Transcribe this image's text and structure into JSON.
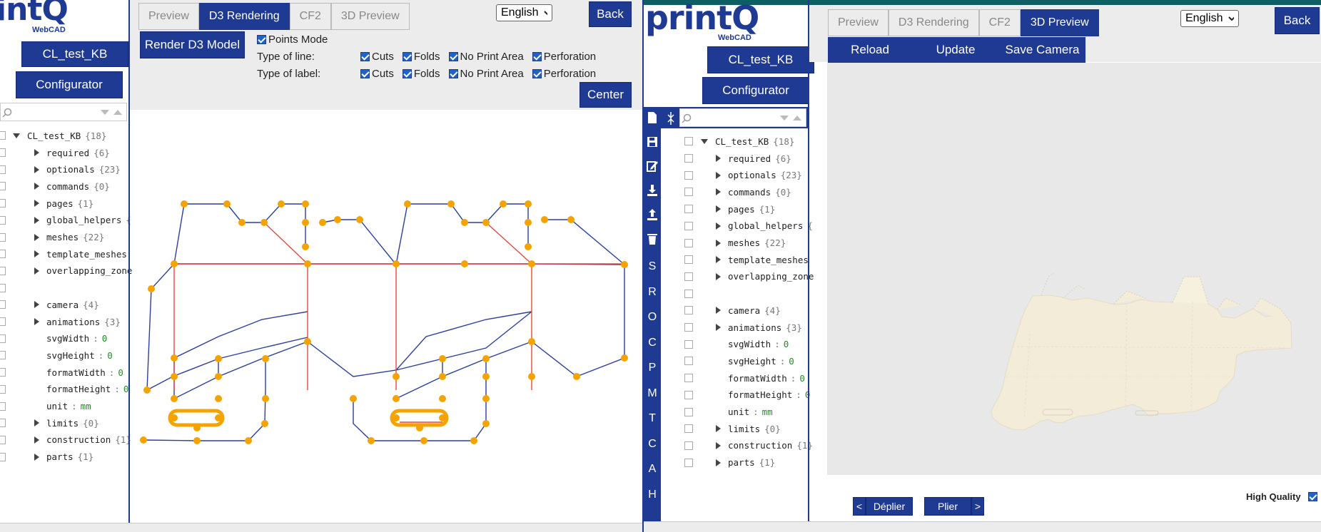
{
  "left": {
    "logo_text": "intQ",
    "logo_sub": "WebCAD",
    "project_button": "CL_test_KB",
    "configurator_button": "Configurator",
    "tabs": [
      {
        "label": "Preview",
        "active": false
      },
      {
        "label": "D3 Rendering",
        "active": true
      },
      {
        "label": "CF2",
        "active": false
      },
      {
        "label": "3D Preview",
        "active": false
      }
    ],
    "language": "English",
    "back_label": "Back",
    "render_button": "Render D3 Model",
    "points_mode_label": "Points Mode",
    "line_type_label": "Type of line:",
    "label_type_label": "Type of label:",
    "options": [
      "Cuts",
      "Folds",
      "No Print Area",
      "Perforation"
    ],
    "center_label": "Center",
    "tree_root": {
      "label": "CL_test_KB",
      "count": "{18}"
    },
    "tree": [
      {
        "label": "required",
        "count": "{6}",
        "type": "node"
      },
      {
        "label": "optionals",
        "count": "{23}",
        "type": "node"
      },
      {
        "label": "commands",
        "count": "{0}",
        "type": "node"
      },
      {
        "label": "pages",
        "count": "{1}",
        "type": "node"
      },
      {
        "label": "global_helpers",
        "count": "{",
        "type": "node"
      },
      {
        "label": "meshes",
        "count": "{22}",
        "type": "node"
      },
      {
        "label": "template_meshes",
        "count": "",
        "type": "node"
      },
      {
        "label": "overlapping_zone",
        "count": "",
        "type": "node"
      },
      {
        "label": "",
        "count": "",
        "type": "blank"
      },
      {
        "label": "camera",
        "count": "{4}",
        "type": "node"
      },
      {
        "label": "animations",
        "count": "{3}",
        "type": "node"
      },
      {
        "label": "svgWidth",
        "value": "0",
        "type": "leaf"
      },
      {
        "label": "svgHeight",
        "value": "0",
        "type": "leaf"
      },
      {
        "label": "formatWidth",
        "value": "0",
        "type": "leaf"
      },
      {
        "label": "formatHeight",
        "value": "0",
        "type": "leaf"
      },
      {
        "label": "unit",
        "value": "mm",
        "type": "leaf"
      },
      {
        "label": "limits",
        "count": "{0}",
        "type": "node"
      },
      {
        "label": "construction",
        "count": "{1}",
        "type": "node"
      },
      {
        "label": "parts",
        "count": "{1}",
        "type": "node"
      }
    ]
  },
  "right": {
    "logo_text": "printQ",
    "logo_sub": "WebCAD",
    "project_button": "CL_test_KB",
    "configurator_button": "Configurator",
    "tabs": [
      {
        "label": "Preview",
        "active": false
      },
      {
        "label": "D3 Rendering",
        "active": false
      },
      {
        "label": "CF2",
        "active": false
      },
      {
        "label": "3D Preview",
        "active": true
      }
    ],
    "language": "English",
    "back_label": "Back",
    "reload_label": "Reload",
    "update_label": "Update",
    "save_camera_label": "Save Camera",
    "deplier_label": "Déplier",
    "plier_label": "Plier",
    "prev_arrow": "<",
    "next_arrow": ">",
    "high_quality_label": "High Quality",
    "side_letters": [
      "S",
      "R",
      "O",
      "C",
      "P",
      "M",
      "T",
      "C",
      "A",
      "H"
    ],
    "tree_root": {
      "label": "CL_test_KB",
      "count": "{18}"
    },
    "tree": [
      {
        "label": "required",
        "count": "{6}",
        "type": "node"
      },
      {
        "label": "optionals",
        "count": "{23}",
        "type": "node"
      },
      {
        "label": "commands",
        "count": "{0}",
        "type": "node"
      },
      {
        "label": "pages",
        "count": "{1}",
        "type": "node"
      },
      {
        "label": "global_helpers",
        "count": "{",
        "type": "node"
      },
      {
        "label": "meshes",
        "count": "{22}",
        "type": "node"
      },
      {
        "label": "template_meshes",
        "count": "",
        "type": "node"
      },
      {
        "label": "overlapping_zone",
        "count": "",
        "type": "node"
      },
      {
        "label": "",
        "count": "",
        "type": "blank"
      },
      {
        "label": "camera",
        "count": "{4}",
        "type": "node"
      },
      {
        "label": "animations",
        "count": "{3}",
        "type": "node"
      },
      {
        "label": "svgWidth",
        "value": "0",
        "type": "leaf"
      },
      {
        "label": "svgHeight",
        "value": "0",
        "type": "leaf"
      },
      {
        "label": "formatWidth",
        "value": "0",
        "type": "leaf"
      },
      {
        "label": "formatHeight",
        "value": "0",
        "type": "leaf"
      },
      {
        "label": "unit",
        "value": "mm",
        "type": "leaf"
      },
      {
        "label": "limits",
        "count": "{0}",
        "type": "node"
      },
      {
        "label": "construction",
        "count": "{1}",
        "type": "node"
      },
      {
        "label": "parts",
        "count": "{1}",
        "type": "node"
      }
    ]
  },
  "colors": {
    "brand": "#1f3a93",
    "cut_line": "#2b3f9e",
    "fold_line": "#e8473a",
    "point": "#f5a300",
    "model_fill": "#f5eedc"
  }
}
